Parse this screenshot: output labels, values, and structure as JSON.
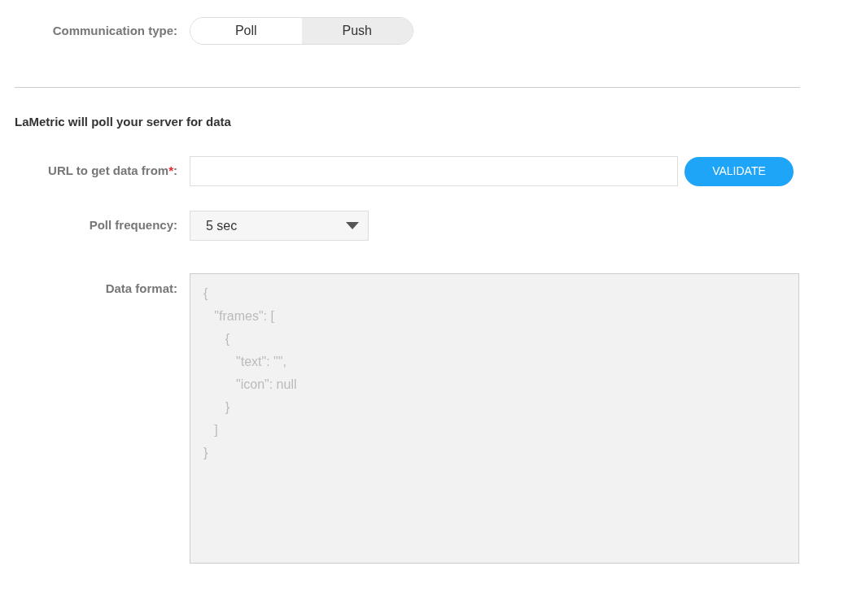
{
  "communication_type": {
    "label": "Communication type:",
    "options": [
      {
        "label": "Poll",
        "selected": true
      },
      {
        "label": "Push",
        "selected": false
      }
    ]
  },
  "section_heading": "LaMetric will poll your server for data",
  "url_field": {
    "label": "URL to get data from",
    "required_mark": "*",
    "label_suffix": ":",
    "button": "VALIDATE"
  },
  "poll_frequency": {
    "label": "Poll frequency:",
    "value": "5 sec"
  },
  "data_format": {
    "label": "Data format:",
    "placeholder": "{\n   \"frames\": [\n      {\n         \"text\": \"\",\n         \"icon\": null\n      }\n   ]\n}"
  }
}
